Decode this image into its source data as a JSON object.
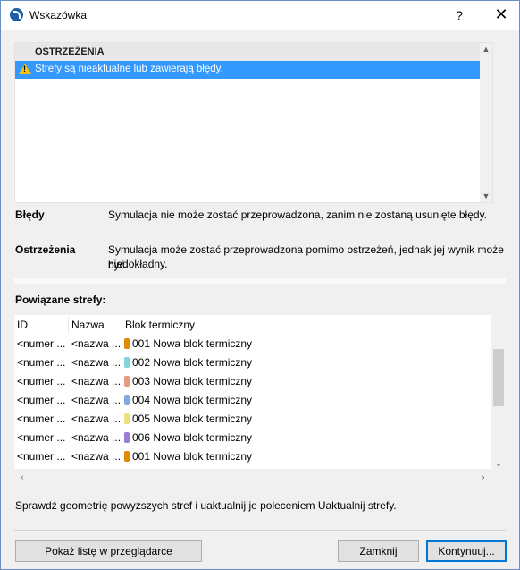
{
  "window": {
    "title": "Wskazówka",
    "help_label": "?",
    "close_label": "✕"
  },
  "warnings": {
    "header": "OSTRZEŻENIA",
    "items": [
      {
        "text": "Strefy są nieaktualne lub zawierają błędy.",
        "icon": "warning-icon",
        "selected": true
      }
    ]
  },
  "info": {
    "errors_label": "Błędy",
    "errors_text": "Symulacja nie może zostać przeprowadzona, zanim nie zostaną usunięte błędy.",
    "warnings_label": "Ostrzeżenia",
    "warnings_text_line1": "Symulacja może zostać przeprowadzona pomimo ostrzeżeń, jednak jej wynik może być",
    "warnings_text_line2": "niedokładny."
  },
  "zones": {
    "title": "Powiązane strefy:",
    "columns": [
      "ID",
      "Nazwa",
      "Blok termiczny"
    ],
    "rows": [
      {
        "id": "<numer ...",
        "name": "<nazwa ...",
        "block": "001 Nowa blok termiczny",
        "color": "#e08a00"
      },
      {
        "id": "<numer ...",
        "name": "<nazwa ...",
        "block": "002 Nowa blok termiczny",
        "color": "#7fd6dc"
      },
      {
        "id": "<numer ...",
        "name": "<nazwa ...",
        "block": "003 Nowa blok termiczny",
        "color": "#e89a82"
      },
      {
        "id": "<numer ...",
        "name": "<nazwa ...",
        "block": "004 Nowa blok termiczny",
        "color": "#86a9dc"
      },
      {
        "id": "<numer ...",
        "name": "<nazwa ...",
        "block": "005 Nowa blok termiczny",
        "color": "#ede07a"
      },
      {
        "id": "<numer ...",
        "name": "<nazwa ...",
        "block": "006 Nowa blok termiczny",
        "color": "#9b7fd4"
      },
      {
        "id": "<numer ...",
        "name": "<nazwa ...",
        "block": "001 Nowa blok termiczny",
        "color": "#e08a00"
      }
    ]
  },
  "footer": {
    "hint": "Sprawdź geometrię powyższych stref i uaktualnij je poleceniem Uaktualnij strefy.",
    "show_list_label": "Pokaż listę w przeglądarce",
    "close_label": "Zamknij",
    "continue_label": "Kontynuuj..."
  },
  "colors": {
    "selection": "#3399ff",
    "accent": "#0078d7"
  }
}
